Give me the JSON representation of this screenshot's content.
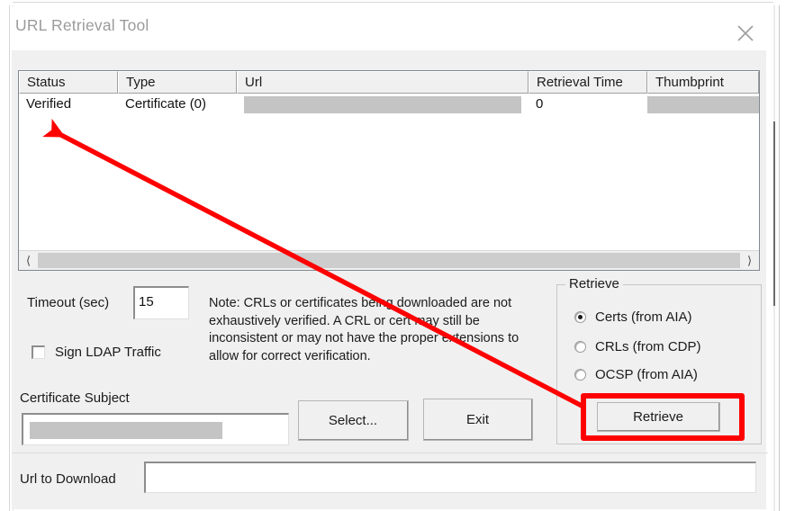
{
  "window": {
    "title": "URL Retrieval Tool",
    "close_icon": "close-icon",
    "ghost_text_fragment": "· ·· ···"
  },
  "list": {
    "columns": [
      "Status",
      "Type",
      "Url",
      "Retrieval Time",
      "Thumbprint"
    ],
    "rows": [
      {
        "status": "Verified",
        "type": "Certificate (0)",
        "url": "",
        "url_redacted": true,
        "retrieval_time": "0",
        "thumbprint": "",
        "thumbprint_redacted": true
      }
    ],
    "hscroll": {
      "left_arrow": "chevron-left-icon",
      "right_arrow": "chevron-right-icon"
    }
  },
  "options": {
    "timeout_label": "Timeout (sec)",
    "timeout_value": "15",
    "sign_ldap_label": "Sign LDAP Traffic",
    "sign_ldap_checked": false,
    "note_text": "Note: CRLs or certificates being downloaded are not exhaustively verified.  A CRL or cert may still be inconsistent or may not have the proper extensions to allow for correct verification."
  },
  "subject": {
    "label": "Certificate Subject",
    "value": "",
    "value_redacted": true,
    "select_button": "Select...",
    "exit_button": "Exit"
  },
  "retrieve_group": {
    "title": "Retrieve",
    "options": [
      {
        "label": "Certs (from AIA)",
        "selected": true
      },
      {
        "label": "CRLs (from CDP)",
        "selected": false
      },
      {
        "label": "OCSP (from AIA)",
        "selected": false
      }
    ],
    "retrieve_button": "Retrieve"
  },
  "download": {
    "label": "Url to Download",
    "value": "",
    "placeholder": ""
  },
  "annotations": {
    "highlight_color": "#fe0000",
    "highlight_target": "Retrieve",
    "arrow_from": "Retrieve button",
    "arrow_to": "Verified status cell"
  },
  "colors": {
    "dialog_bg": "#f0f0f0",
    "list_bg": "#ffffff",
    "redaction": "#c4c4c4",
    "title_text": "#9b9b9b",
    "annotation_red": "#fe0000"
  }
}
